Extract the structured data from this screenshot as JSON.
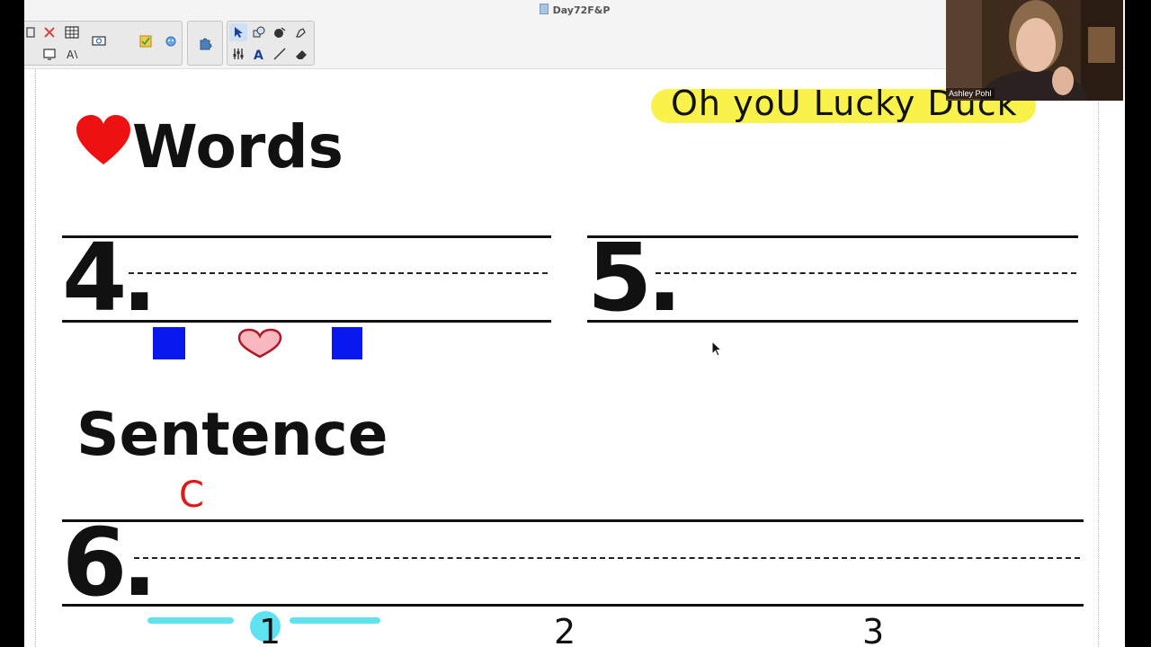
{
  "window": {
    "title": "Day72F&P"
  },
  "toolbar": {
    "groups": [
      {
        "tools": [
          "page-sorter-icon",
          "delete-icon",
          "table-icon",
          "screen-capture-icon",
          "add-page-icon",
          "text-fit-icon"
        ]
      },
      {
        "tools": [
          "response-icon"
        ]
      },
      {
        "tools": [
          "gadget-icon"
        ]
      },
      {
        "tools": [
          "select-arrow-icon",
          "shapes-icon",
          "fill-icon",
          "pen-settings-icon",
          "text-tool-icon",
          "line-tool-icon",
          "eraser-icon"
        ]
      }
    ]
  },
  "page": {
    "words_heading": "Words",
    "sentence_heading": "Sentence",
    "banner": "Oh yoU Lucky Duck",
    "line_numbers": {
      "four": "4.",
      "five": "5.",
      "six": "6."
    },
    "annotation_letter": "C",
    "count_labels": {
      "one": "1",
      "two": "2",
      "three": "3"
    },
    "colors": {
      "heart": "#ee1111",
      "square": "#0a18f0",
      "banner": "#f8f24a",
      "annotation": "#e01818",
      "dash": "#5fe3f0"
    }
  },
  "video": {
    "participant_name": "Ashley Pohl"
  }
}
